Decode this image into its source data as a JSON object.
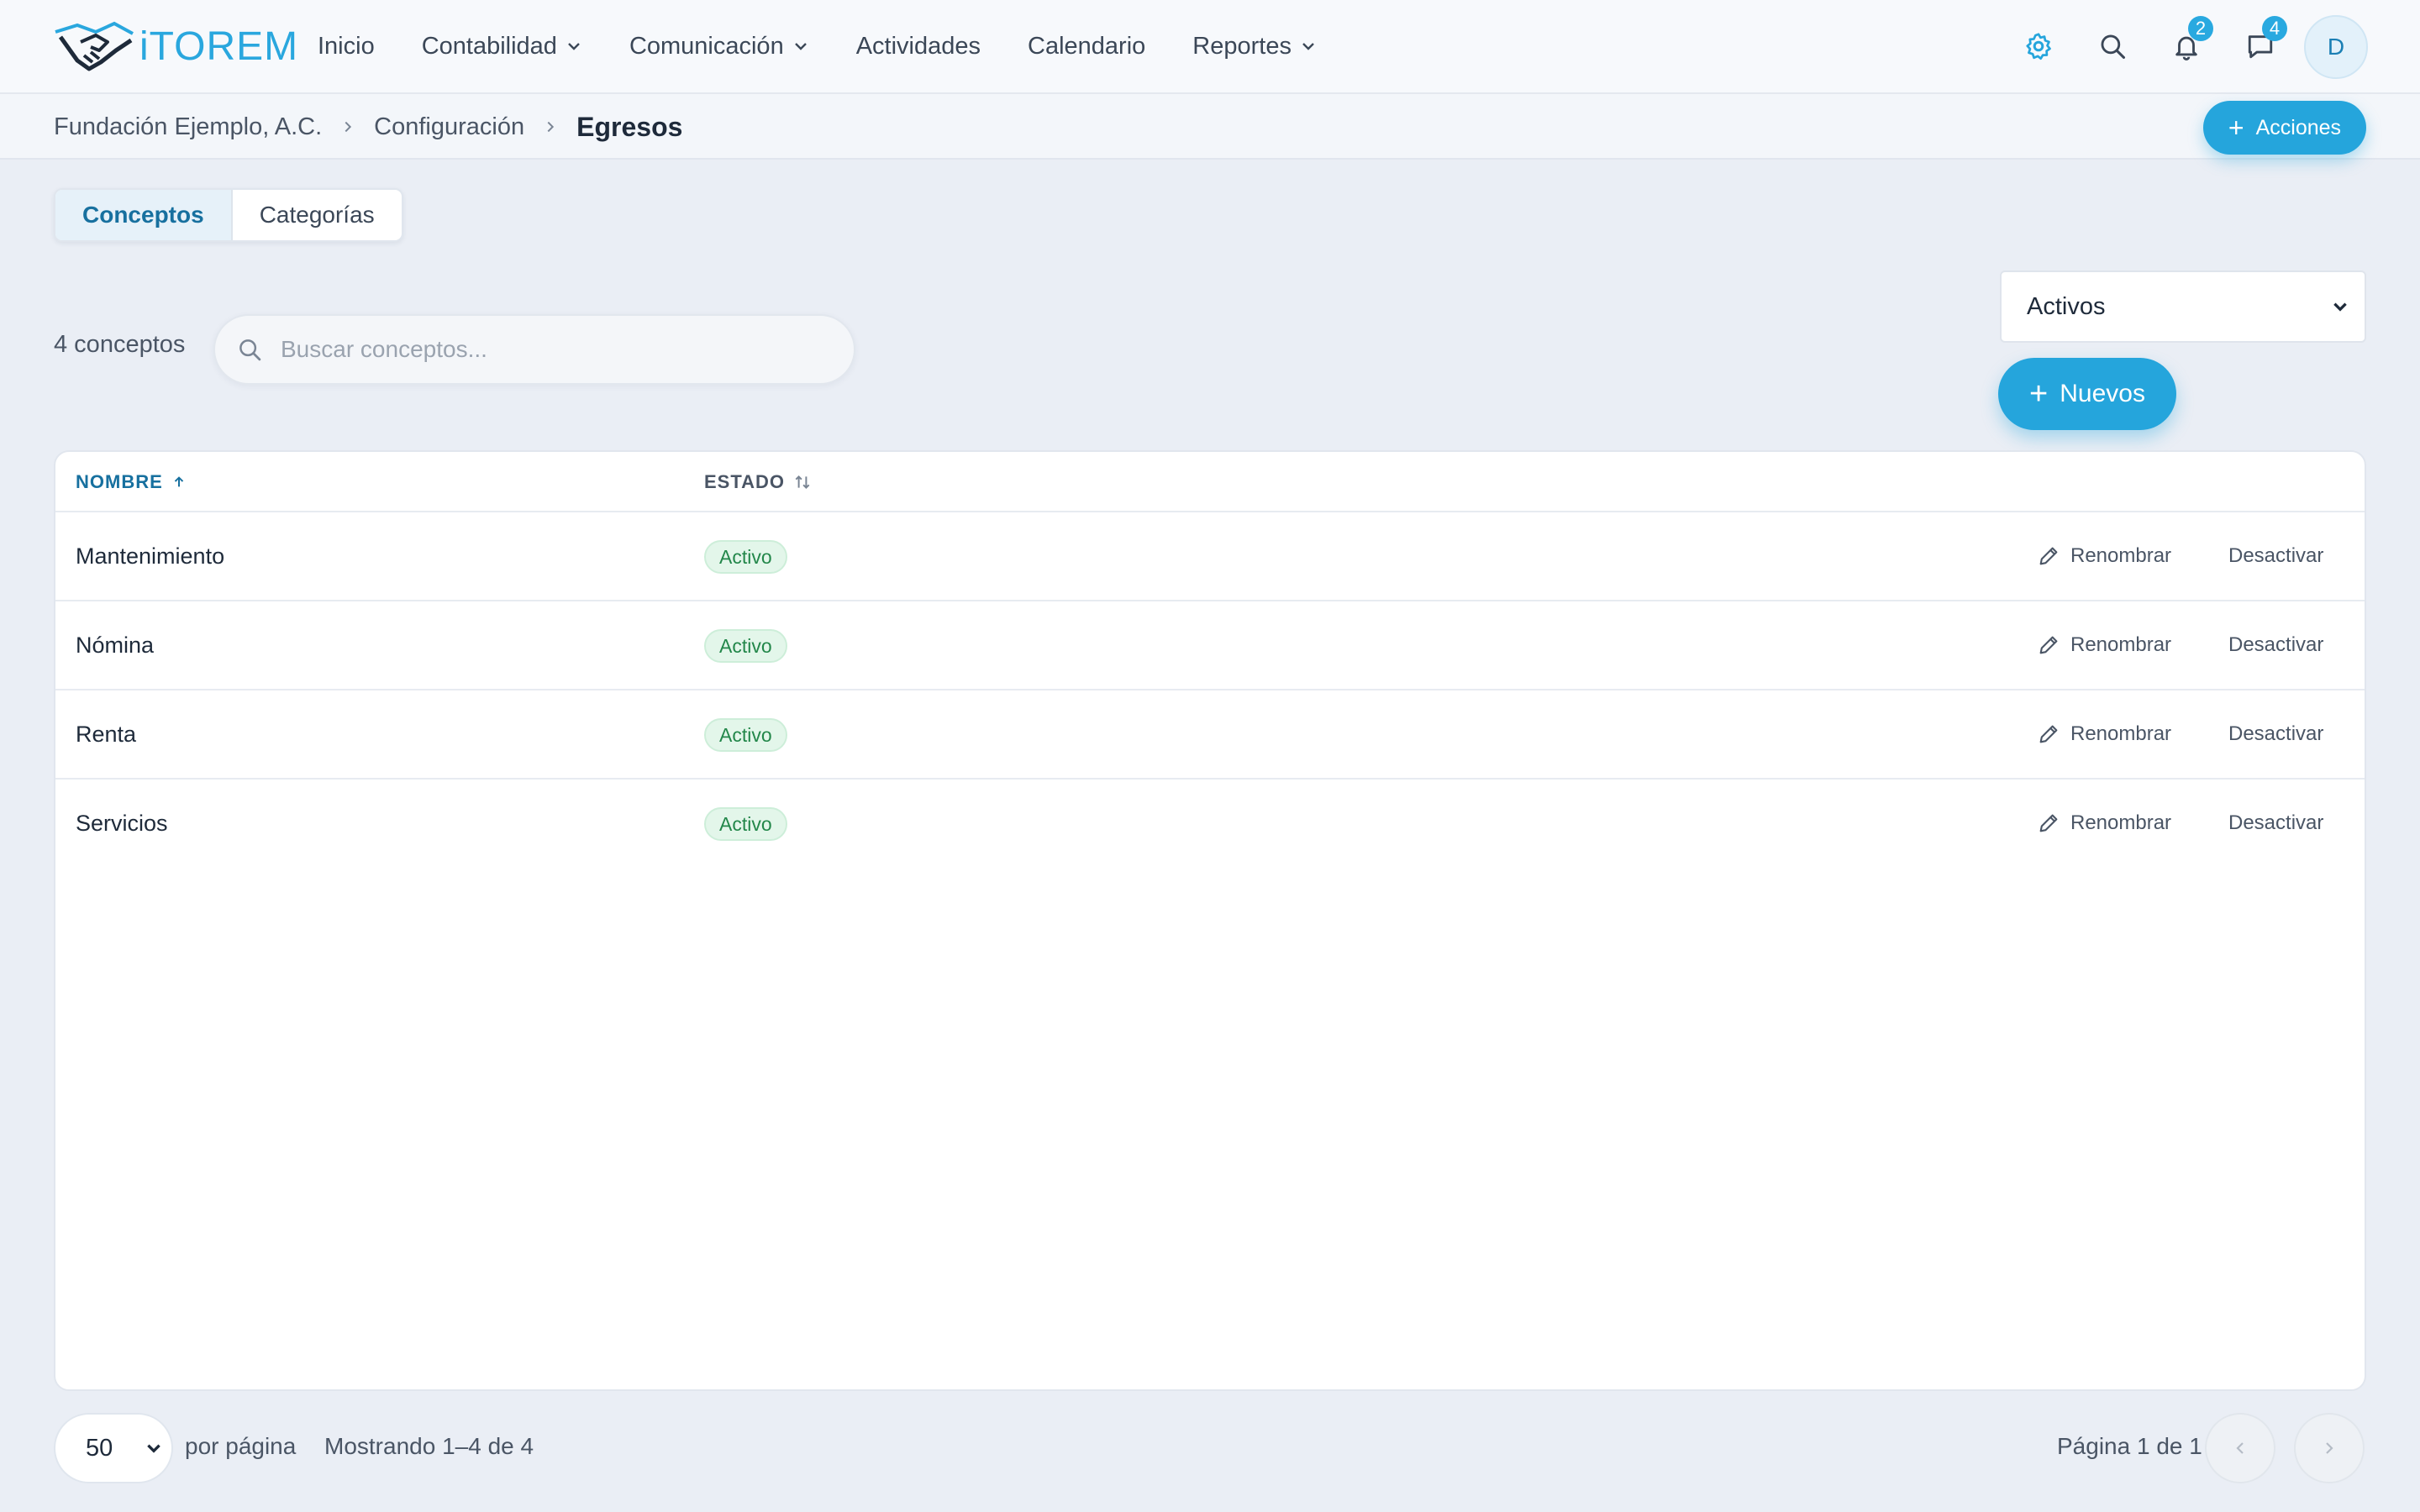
{
  "app": {
    "logo_text": "iTOREM"
  },
  "nav": {
    "items": [
      {
        "label": "Inicio",
        "dropdown": false
      },
      {
        "label": "Contabilidad",
        "dropdown": true
      },
      {
        "label": "Comunicación",
        "dropdown": true
      },
      {
        "label": "Actividades",
        "dropdown": false
      },
      {
        "label": "Calendario",
        "dropdown": false
      },
      {
        "label": "Reportes",
        "dropdown": true
      }
    ]
  },
  "header": {
    "notifications_count": "2",
    "messages_count": "4",
    "avatar_initial": "D"
  },
  "breadcrumb": {
    "items": [
      "Fundación Ejemplo, A.C.",
      "Configuración"
    ],
    "current": "Egresos"
  },
  "actions_button": "Acciones",
  "tabs": [
    {
      "label": "Conceptos",
      "active": true
    },
    {
      "label": "Categorías",
      "active": false
    }
  ],
  "toolbar": {
    "count_label": "4 conceptos",
    "search_placeholder": "Buscar conceptos...",
    "filter_value": "Activos",
    "new_button": "Nuevos"
  },
  "table": {
    "columns": {
      "name": "NOMBRE",
      "state": "ESTADO"
    },
    "rows": [
      {
        "name": "Mantenimiento",
        "status": "Activo"
      },
      {
        "name": "Nómina",
        "status": "Activo"
      },
      {
        "name": "Renta",
        "status": "Activo"
      },
      {
        "name": "Servicios",
        "status": "Activo"
      }
    ],
    "rename_label": "Renombrar",
    "deactivate_label": "Desactivar"
  },
  "pagination": {
    "page_size": "50",
    "per_page_label": "por página",
    "showing": "Mostrando 1–4 de 4",
    "page_label": "Página 1 de 1"
  },
  "colors": {
    "accent": "#25a5dc",
    "status_active_bg": "#e3f6ea",
    "status_active_text": "#23874a"
  }
}
